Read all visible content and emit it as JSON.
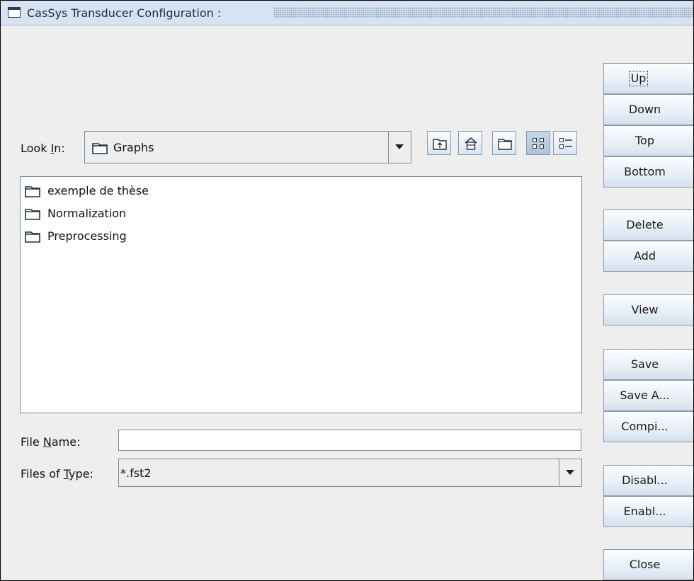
{
  "window": {
    "title": "CasSys Transducer Configuration :"
  },
  "file_chooser": {
    "look_in_label_pre": "Look ",
    "look_in_label_mnemonic": "I",
    "look_in_label_post": "n:",
    "look_in_value": "Graphs",
    "toolbar_icons": [
      "up-folder-icon",
      "home-icon",
      "new-folder-icon",
      "list-view-icon",
      "details-view-icon"
    ],
    "files": [
      {
        "name": "exemple de thèse",
        "icon": "folder-icon"
      },
      {
        "name": "Normalization",
        "icon": "folder-icon"
      },
      {
        "name": "Preprocessing",
        "icon": "folder-icon"
      }
    ],
    "file_name_label_pre": "File ",
    "file_name_label_mnemonic": "N",
    "file_name_label_post": "ame:",
    "file_name_value": "",
    "files_of_type_label_pre": "Files of ",
    "files_of_type_label_mnemonic": "T",
    "files_of_type_label_post": "ype:",
    "files_of_type_value": "*.fst2"
  },
  "side_buttons": {
    "up": "Up",
    "down": "Down",
    "top": "Top",
    "bottom": "Bottom",
    "delete": "Delete",
    "add": "Add",
    "view": "View",
    "save": "Save",
    "save_as": "Save A...",
    "compile": "Compi...",
    "disable": "Disabl...",
    "enable": "Enabl...",
    "close": "Close"
  },
  "colors": {
    "title_bar": "#d7e3f2",
    "panel": "#eeeeee",
    "button_top": "#fcfdff",
    "button_bottom": "#d6e1ee"
  }
}
